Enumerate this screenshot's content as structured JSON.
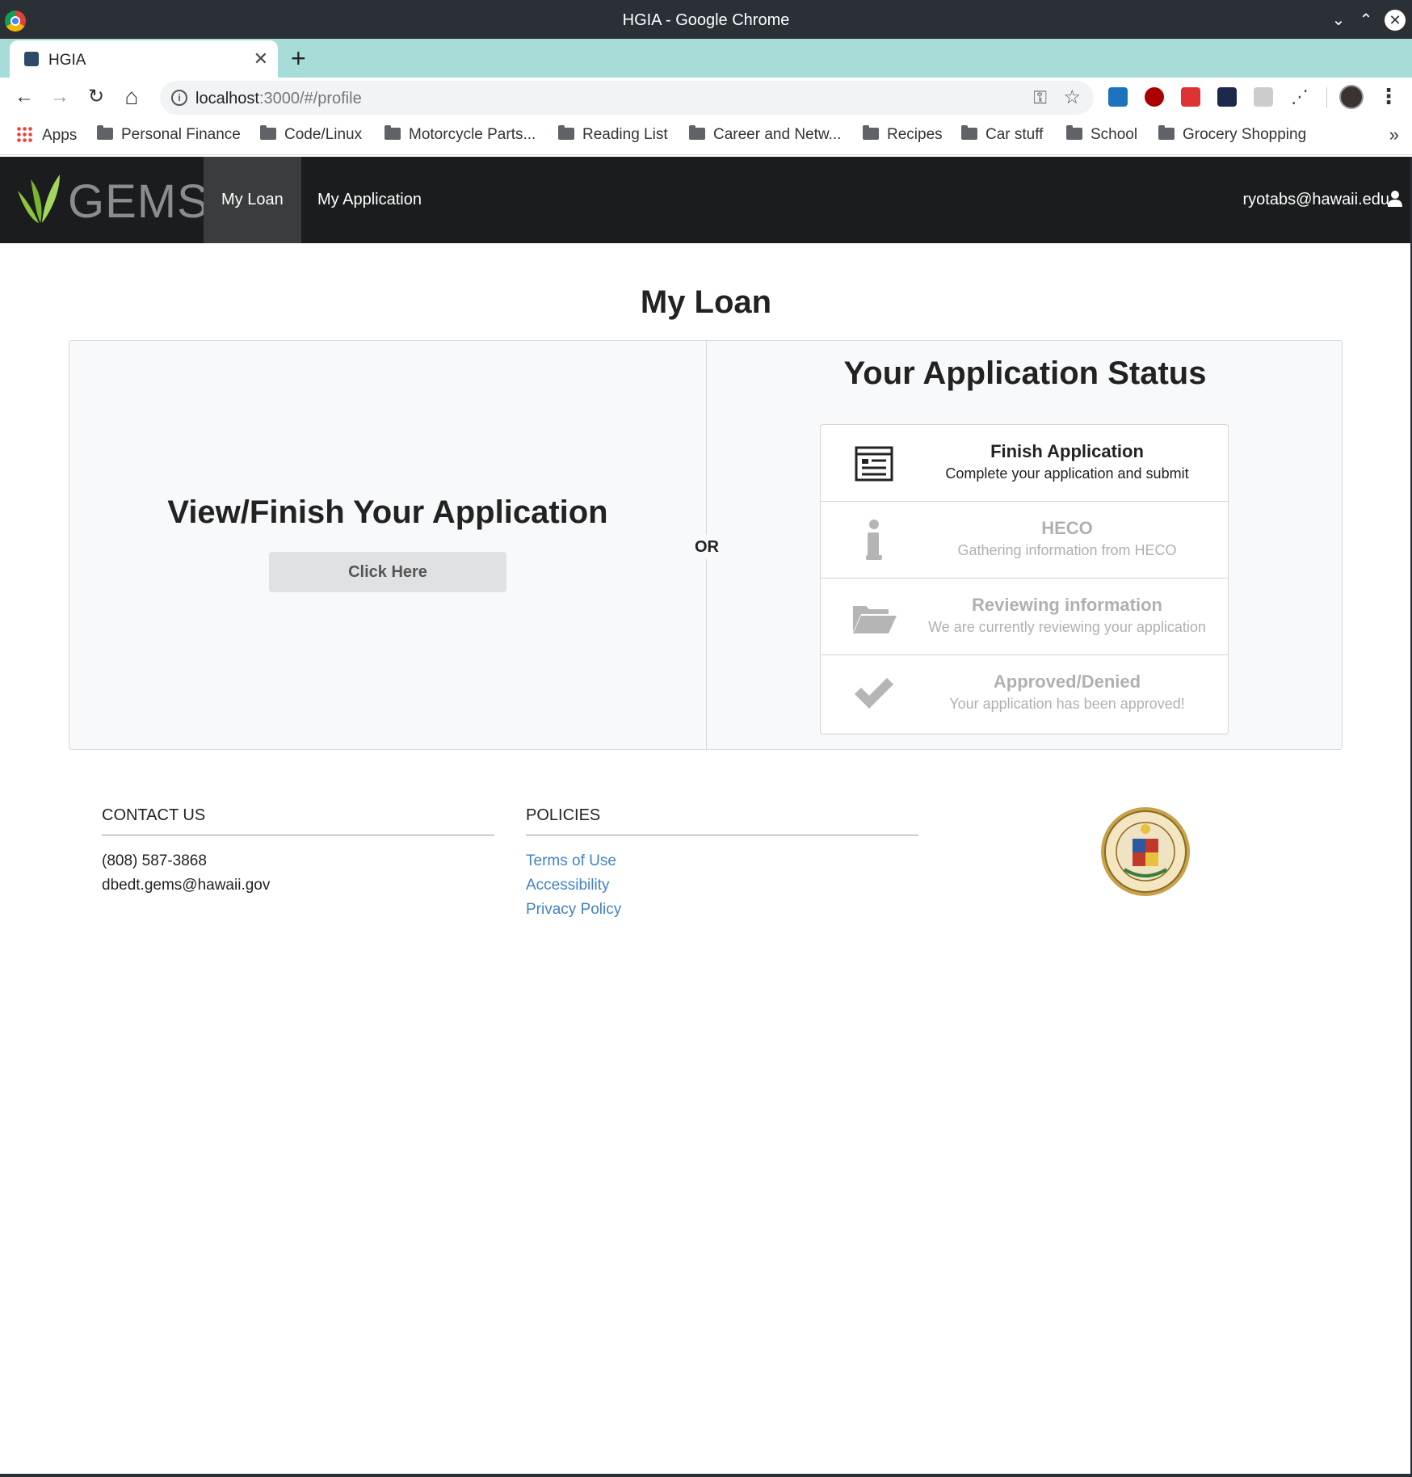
{
  "window": {
    "title": "HGIA - Google Chrome"
  },
  "tab": {
    "title": "HGIA",
    "close": "✕",
    "new_tab": "+"
  },
  "toolbar": {
    "url_host": "localhost",
    "url_path": ":3000/#/profile",
    "back": "←",
    "forward": "→",
    "reload": "↻",
    "home": "⌂"
  },
  "bookmarks": {
    "apps": "Apps",
    "items": [
      "Personal Finance",
      "Code/Linux",
      "Motorcycle Parts...",
      "Reading List",
      "Career and Netw...",
      "Recipes",
      "Car stuff",
      "School",
      "Grocery Shopping"
    ],
    "more": "»"
  },
  "navbar": {
    "brand": "GEMS",
    "items": [
      "My Loan",
      "My Application"
    ],
    "active": "My Loan",
    "user": "ryotabs@hawaii.edu"
  },
  "main": {
    "title": "My Loan",
    "left_heading": "View/Finish Your Application",
    "button_label": "Click Here",
    "or_label": "OR",
    "status_heading": "Your Application Status",
    "steps": [
      {
        "title": "Finish Application",
        "description": "Complete your application and submit",
        "icon": "newspaper-icon",
        "active": true
      },
      {
        "title": "HECO",
        "description": "Gathering information from HECO",
        "icon": "info-icon",
        "active": false
      },
      {
        "title": "Reviewing information",
        "description": "We are currently reviewing your application",
        "icon": "folder-open-icon",
        "active": false
      },
      {
        "title": "Approved/Denied",
        "description": "Your application has been approved!",
        "icon": "checkmark-icon",
        "active": false
      }
    ]
  },
  "footer": {
    "contact": {
      "heading": "CONTACT US",
      "phone": "(808) 587-3868",
      "email": "dbedt.gems@hawaii.gov"
    },
    "policies": {
      "heading": "POLICIES",
      "links": [
        "Terms of Use",
        "Accessibility",
        "Privacy Policy"
      ]
    }
  },
  "colors": {
    "navbar_bg": "#1b1c1d",
    "tabstrip_bg": "#a8dcd9",
    "link": "#4183c4",
    "disabled_text": "#b0b0b0",
    "brand_green": "#8cc63f"
  }
}
